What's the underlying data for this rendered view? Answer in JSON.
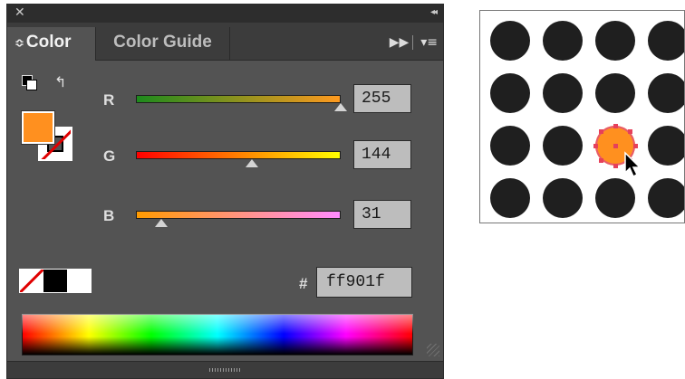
{
  "panel": {
    "close_glyph": "✕",
    "collapse_glyph": "◂◂",
    "tabs": [
      {
        "label": "Color",
        "active": true
      },
      {
        "label": "Color Guide",
        "active": false
      }
    ],
    "tab_updown_glyph": "≎",
    "icons": [
      "fast-forward-icon",
      "panel-menu-icon"
    ]
  },
  "fill_color": "#ff901f",
  "channels": [
    {
      "label": "R",
      "value": "255",
      "gradient": [
        "#1d8a1d",
        "#ff9a1f"
      ],
      "level": 1.0
    },
    {
      "label": "G",
      "value": "144",
      "gradient": [
        "#ff0000",
        "#ffff00"
      ],
      "level": 0.565
    },
    {
      "label": "B",
      "value": "31",
      "gradient": [
        "#ff9a00",
        "#ff8cff"
      ],
      "level": 0.122
    }
  ],
  "hex": {
    "prefix": "#",
    "value": "ff901f"
  },
  "swatches": [
    "none",
    "black",
    "white"
  ],
  "canvas": {
    "rows": 4,
    "cols": 4,
    "selected": {
      "row": 3,
      "col": 3
    },
    "dot_color": "#1f1f1f",
    "selected_color": "#ff901f"
  }
}
